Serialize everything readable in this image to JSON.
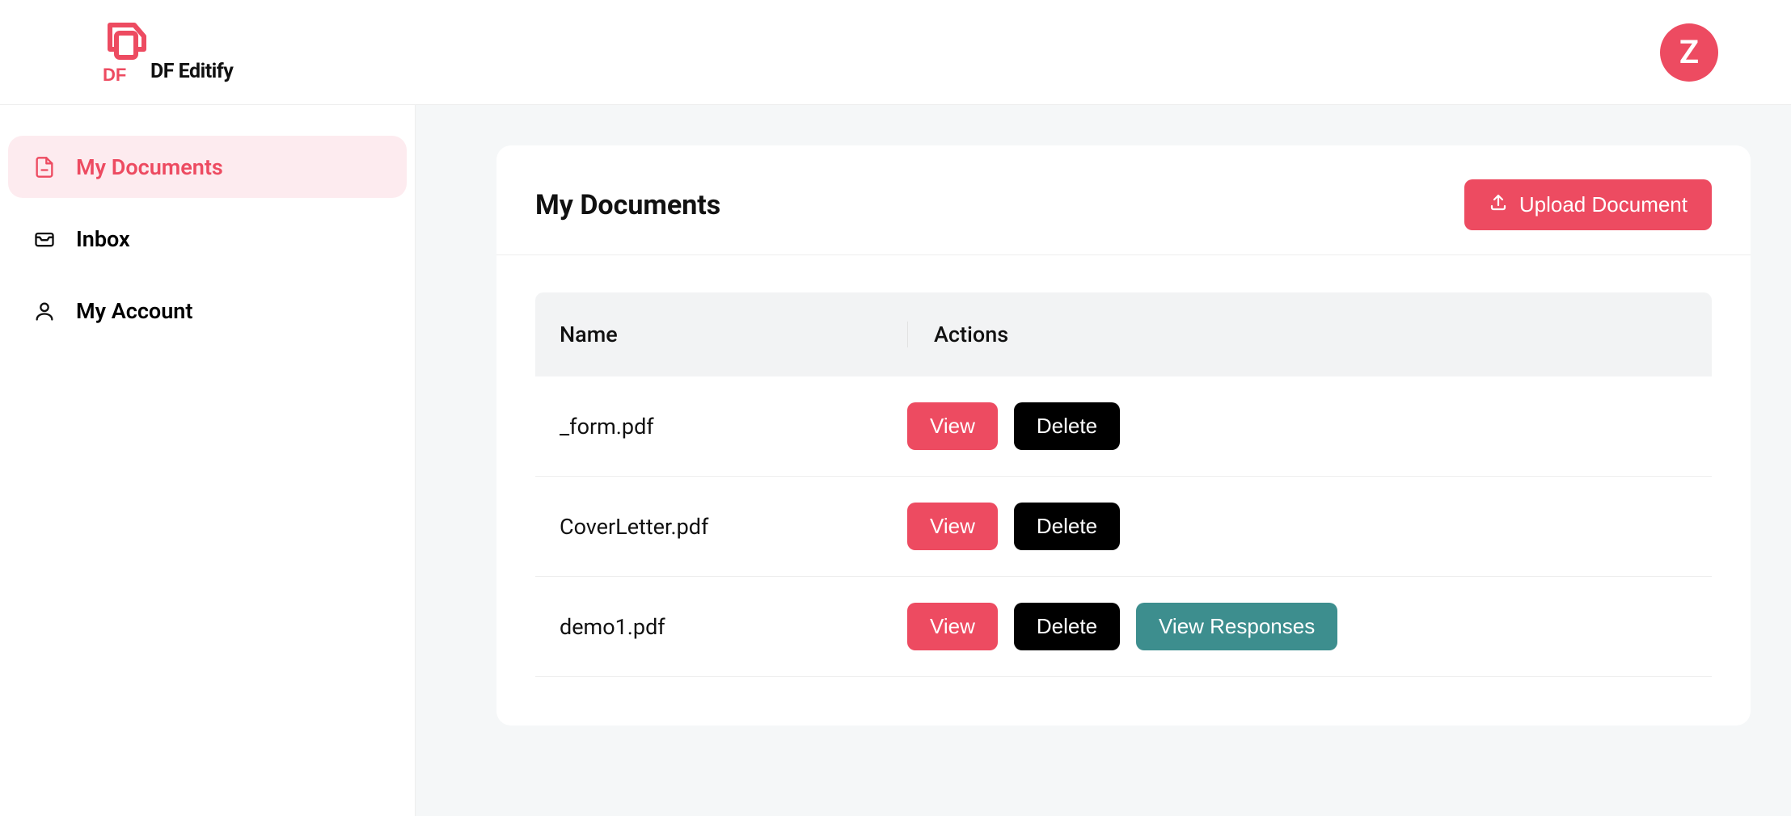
{
  "app": {
    "brand_text": "DF Editify"
  },
  "header": {
    "avatar_initial": "Z"
  },
  "sidebar": {
    "items": [
      {
        "label": "My Documents",
        "icon": "file-icon",
        "active": true
      },
      {
        "label": "Inbox",
        "icon": "inbox-icon",
        "active": false
      },
      {
        "label": "My Account",
        "icon": "user-icon",
        "active": false
      }
    ]
  },
  "main": {
    "title": "My Documents",
    "upload_label": "Upload Document",
    "table": {
      "columns": {
        "name": "Name",
        "actions": "Actions"
      },
      "rows": [
        {
          "name": "_form.pdf",
          "view": "View",
          "delete": "Delete",
          "responses": null
        },
        {
          "name": "CoverLetter.pdf",
          "view": "View",
          "delete": "Delete",
          "responses": null
        },
        {
          "name": "demo1.pdf",
          "view": "View",
          "delete": "Delete",
          "responses": "View Responses"
        }
      ]
    }
  }
}
